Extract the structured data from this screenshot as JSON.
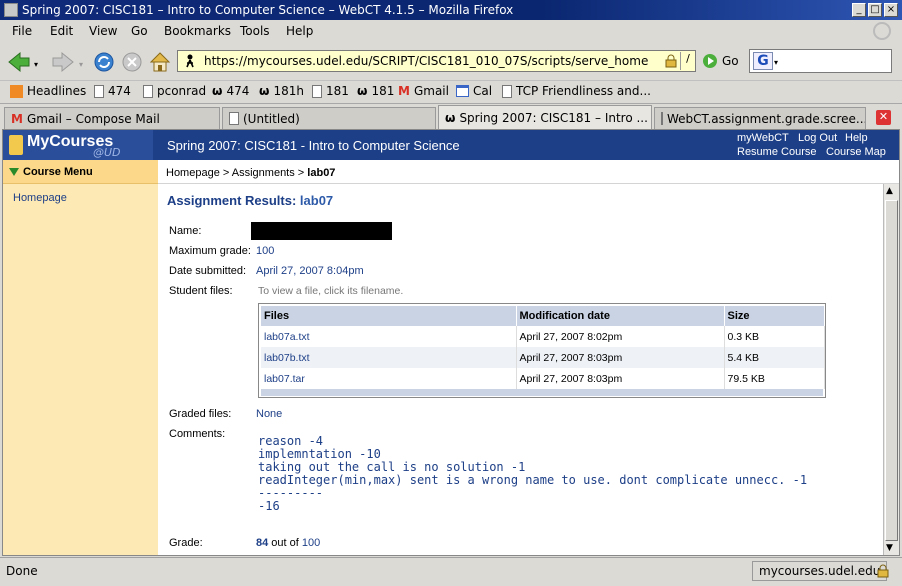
{
  "window": {
    "title": "Spring 2007: CISC181 – Intro to Computer Science – WebCT 4.1.5 – Mozilla Firefox"
  },
  "menubar": {
    "items": [
      "File",
      "Edit",
      "View",
      "Go",
      "Bookmarks",
      "Tools",
      "Help"
    ]
  },
  "navbar": {
    "url": "https://mycourses.udel.edu/SCRIPT/CISC181_010_07S/scripts/serve_home",
    "go_label": "Go",
    "search_value": ""
  },
  "bookmarks": {
    "items": [
      "Headlines",
      "474",
      "pconrad",
      "474",
      "181h",
      "181",
      "181",
      "Gmail",
      "Cal",
      "TCP Friendliness and..."
    ]
  },
  "tabs": [
    {
      "label": "Gmail – Compose Mail"
    },
    {
      "label": "(Untitled)"
    },
    {
      "label": "Spring 2007: CISC181 – Intro ..."
    },
    {
      "label": "WebCT.assignment.grade.scree..."
    }
  ],
  "webct": {
    "logo": "MyCourses",
    "logo_sub": "@UD",
    "course_title": "Spring 2007: CISC181 - Intro to Computer Science",
    "links": {
      "mywebct": "myWebCT",
      "logout": "Log Out",
      "help": "Help",
      "resume": "Resume Course",
      "coursemap": "Course Map"
    },
    "course_menu": "Course Menu",
    "menu_home": "Homepage",
    "breadcrumb": {
      "home": "Homepage",
      "sep": " > ",
      "assign": "Assignments",
      "current": "lab07"
    }
  },
  "assignment": {
    "heading_prefix": "Assignment Results: ",
    "heading_name": "lab07",
    "name_label": "Name:",
    "max_label": "Maximum grade:",
    "max_value": "100",
    "date_label": "Date submitted:",
    "date_value": "April 27, 2007 8:04pm",
    "files_label": "Student files:",
    "files_hint": "To view a file, click its filename.",
    "files_headers": [
      "Files",
      "Modification date",
      "Size"
    ],
    "files": [
      {
        "name": "lab07a.txt",
        "date": "April 27, 2007 8:02pm",
        "size": "0.3 KB"
      },
      {
        "name": "lab07b.txt",
        "date": "April 27, 2007 8:03pm",
        "size": "5.4 KB"
      },
      {
        "name": "lab07.tar",
        "date": "April 27, 2007 8:03pm",
        "size": "79.5 KB"
      }
    ],
    "graded_label": "Graded files:",
    "graded_value": "None",
    "comments_label": "Comments:",
    "comments": "reason -4\nimplemntation -10\ntaking out the call is no solution -1\nreadInteger(min,max) sent is a wrong name to use. dont complicate unnecc. -1\n---------\n-16",
    "grade_label": "Grade:",
    "grade_value": "84",
    "grade_out_of": " out of ",
    "grade_max": "100"
  },
  "status": {
    "left": "Done",
    "right": "mycourses.udel.edu"
  }
}
